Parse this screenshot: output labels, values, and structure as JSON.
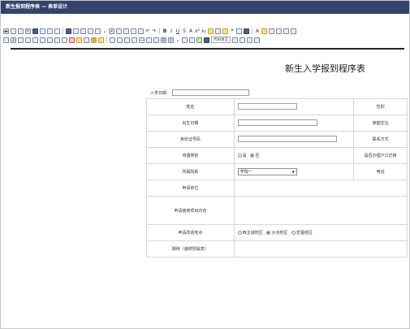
{
  "window": {
    "title": "新生报到程序表 — 表单设计"
  },
  "toolbar": {
    "font_size_select": "代码语言"
  },
  "document": {
    "title": "新生入学报到程序表",
    "entry_date_label": "入学日期："
  },
  "form": {
    "rows": [
      {
        "left_label": "姓名",
        "right_label": "性别"
      },
      {
        "left_label": "出生日期",
        "right_label": "家庭住址"
      },
      {
        "left_label": "身份证号码",
        "right_label": "联系方式"
      },
      {
        "left_label": "待遇类别",
        "right_label": "是否办理户口迁移"
      },
      {
        "left_label": "所属院系",
        "right_label": "电话"
      },
      {
        "left_label": "申请单位"
      },
      {
        "left_label": "申请装修项目内容"
      },
      {
        "left_label": "申请改造地点"
      },
      {
        "left_label": "期待（装修附属表）"
      }
    ],
    "treatment_options": [
      "是",
      "否"
    ],
    "treatment_selected": "否",
    "department_value": "学院一",
    "campus_options": [
      "西主城校区",
      "沙河校区",
      "宏福校区"
    ],
    "campus_selected": "沙河校区"
  }
}
